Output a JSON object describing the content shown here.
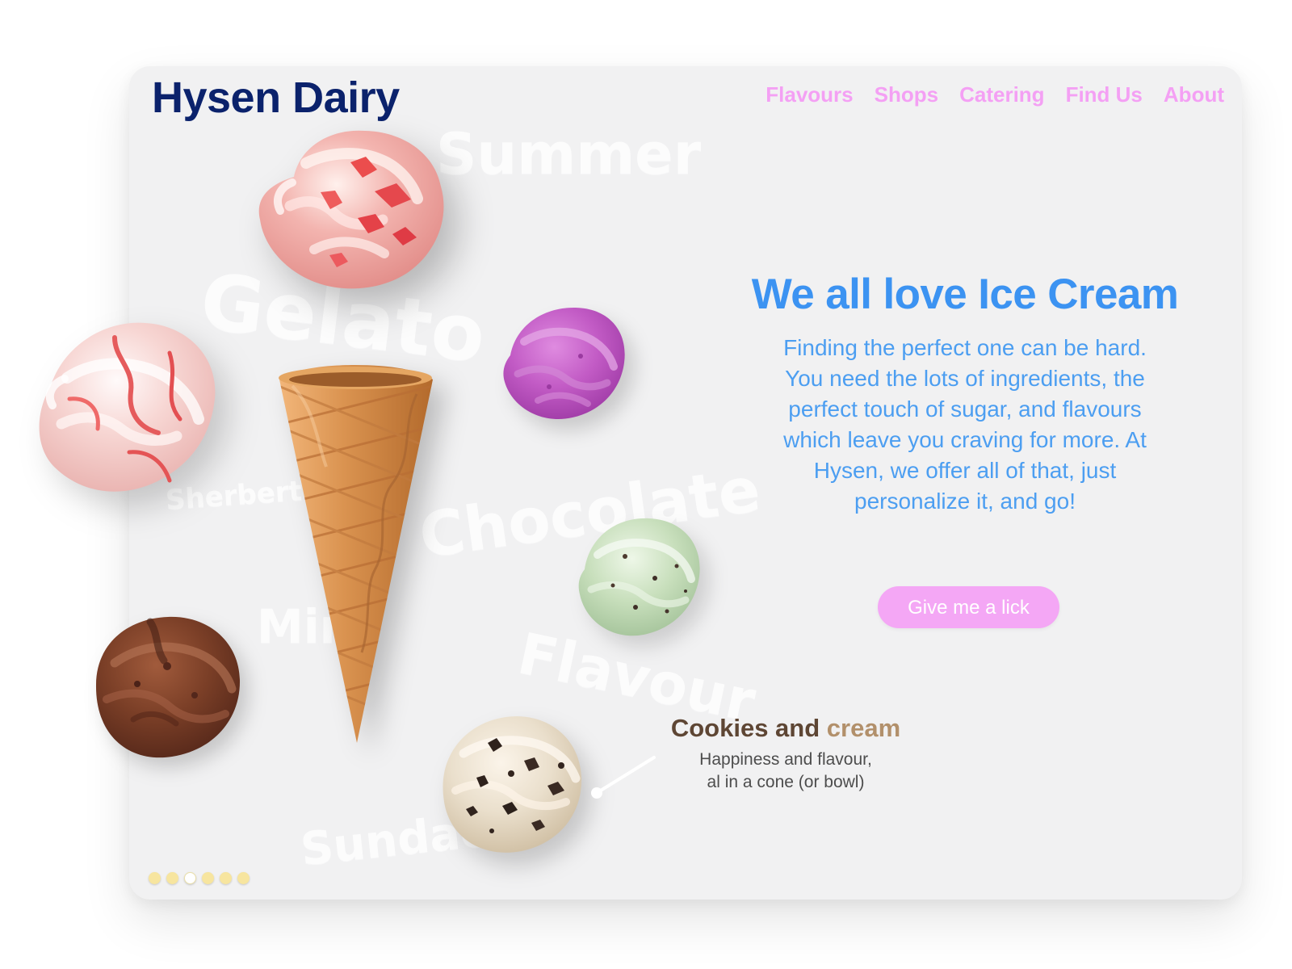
{
  "header": {
    "brand": "Hysen Dairy",
    "nav": [
      {
        "label": "Flavours"
      },
      {
        "label": "Shops"
      },
      {
        "label": "Catering"
      },
      {
        "label": "Find Us"
      },
      {
        "label": "About"
      }
    ]
  },
  "hero": {
    "title": "We all love Ice Cream",
    "copy": "Finding the perfect one can be hard. You need the lots of ingredients, the perfect touch of sugar, and flavours which leave you craving for more. At Hysen, we offer all of that, just personalize it, and go!",
    "cta_label": "Give me a lick"
  },
  "watermarks": {
    "summer": "Summer",
    "gelato": "Gelato",
    "chocolate": "Chocolate",
    "sherbert": "Sherbert",
    "mint": "Mint",
    "flavour": "Flavour",
    "sundae": "Sundae"
  },
  "featured": {
    "title_main": "Cookies and",
    "title_accent": "cream",
    "lines": [
      "Happiness and flavour,",
      "al in a cone (or bowl)"
    ]
  },
  "carousel": {
    "total": 6,
    "active_index": 2
  },
  "illustrations": [
    {
      "name": "strawberry-scoop-icon",
      "colour": "#f1a8a6"
    },
    {
      "name": "raspberry-swirl-scoop-icon",
      "colour": "#f4cbc7"
    },
    {
      "name": "berry-scoop-icon",
      "colour": "#c45bc7"
    },
    {
      "name": "mint-chip-scoop-icon",
      "colour": "#c8dfbc"
    },
    {
      "name": "chocolate-scoop-icon",
      "colour": "#7a3e25"
    },
    {
      "name": "cookies-and-cream-scoop-icon",
      "colour": "#eadfcc"
    },
    {
      "name": "waffle-cone-icon",
      "colour": "#d7924e"
    }
  ],
  "colors": {
    "card_background": "#f1f1f2",
    "brand": "#0b226c",
    "nav": "#f4a0f4",
    "hero_title": "#3c93f2",
    "hero_copy": "#4c9ef1",
    "cta_background": "#f4a7f5",
    "caption_title": "#5e4634",
    "caption_accent": "#b2906b",
    "caption_text": "#4d4d4d",
    "dot": "#f7e59f",
    "dot_active": "#ffffff"
  }
}
